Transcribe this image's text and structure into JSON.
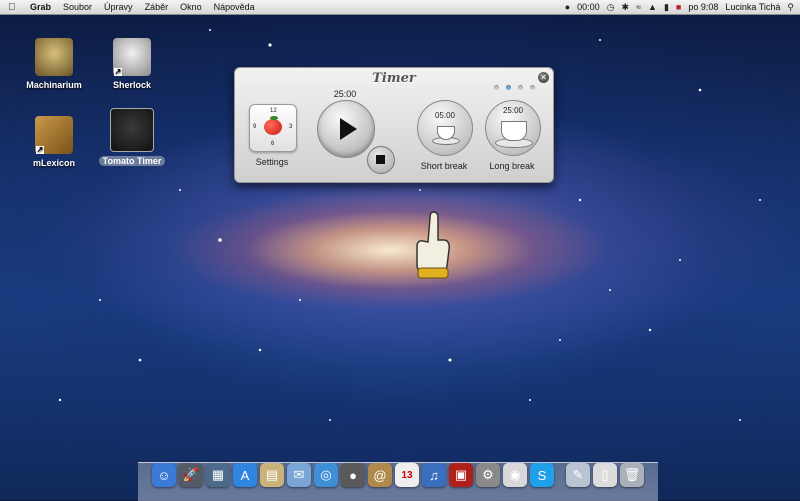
{
  "menubar": {
    "app_name": "Grab",
    "menus": [
      "Soubor",
      "Úpravy",
      "Záběr",
      "Okno",
      "Nápověda"
    ],
    "timer_readout": "00:00",
    "language_flag": "US",
    "clock": "po 9:08",
    "user": "Lucinka Tichá"
  },
  "desktop_icons": [
    {
      "label": "Machinarium"
    },
    {
      "label": "Sherlock"
    },
    {
      "label": "mLexicon"
    },
    {
      "label": "Tomato Timer"
    }
  ],
  "timer_widget": {
    "title": "Timer",
    "close_glyph": "✕",
    "page_dots": [
      false,
      true,
      false,
      false
    ],
    "settings": {
      "label": "Settings",
      "clock_numbers": [
        "12",
        "3",
        "6",
        "9"
      ]
    },
    "work_time": "25:00",
    "short_break": {
      "label": "Short break",
      "time": "05:00"
    },
    "long_break": {
      "label": "Long break",
      "time": "25:00"
    }
  },
  "dock": {
    "items": [
      {
        "name": "finder-icon",
        "color": "#3b7bd8",
        "glyph": "☺"
      },
      {
        "name": "launchpad-icon",
        "color": "#555b66",
        "glyph": "🚀"
      },
      {
        "name": "mission-control-icon",
        "color": "#4c6a8a",
        "glyph": "▦"
      },
      {
        "name": "app-store-icon",
        "color": "#2f86e0",
        "glyph": "A"
      },
      {
        "name": "preview-icon",
        "color": "#c9b37a",
        "glyph": "▤"
      },
      {
        "name": "mail-icon",
        "color": "#7aa6d6",
        "glyph": "✉"
      },
      {
        "name": "safari-icon",
        "color": "#3f8fd6",
        "glyph": "◎"
      },
      {
        "name": "facetime-icon",
        "color": "#5a5a5a",
        "glyph": "●"
      },
      {
        "name": "contacts-icon",
        "color": "#b08a4c",
        "glyph": "@"
      },
      {
        "name": "calendar-icon",
        "color": "#eeeeee",
        "glyph": "13"
      },
      {
        "name": "itunes-icon",
        "color": "#3a6fc0",
        "glyph": "♫"
      },
      {
        "name": "photo-booth-icon",
        "color": "#b0201a",
        "glyph": "▣"
      },
      {
        "name": "system-preferences-icon",
        "color": "#8a8a8a",
        "glyph": "⚙"
      },
      {
        "name": "chrome-icon",
        "color": "#d8d8d8",
        "glyph": "◉"
      },
      {
        "name": "skype-icon",
        "color": "#1fa0e8",
        "glyph": "S"
      },
      {
        "name": "applications-folder-icon",
        "color": "#b9c3d2",
        "glyph": "✎"
      },
      {
        "name": "documents-folder-icon",
        "color": "#dcdcdc",
        "glyph": "▯"
      },
      {
        "name": "trash-icon",
        "color": "#aab0b8",
        "glyph": "🗑"
      }
    ]
  }
}
